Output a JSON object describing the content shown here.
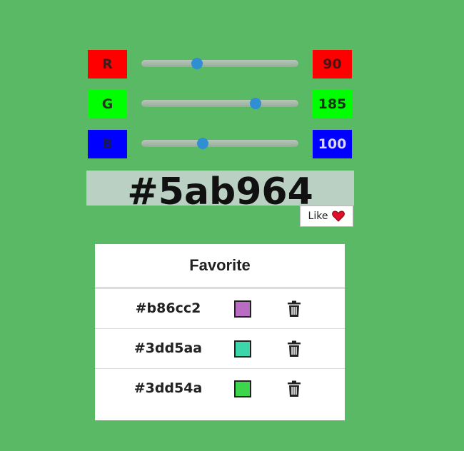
{
  "sliders": {
    "r": {
      "label": "R",
      "value": "90",
      "fraction": 0.353,
      "box_color": "#ff0000"
    },
    "g": {
      "label": "G",
      "value": "185",
      "fraction": 0.725,
      "box_color": "#00ff00"
    },
    "b": {
      "label": "B",
      "value": "100",
      "fraction": 0.392,
      "box_color": "#0000ff"
    }
  },
  "current_color": {
    "hex": "#5ab964"
  },
  "like_button": {
    "label": "Like",
    "icon": "heart-icon",
    "icon_color": "#e0102a"
  },
  "favorites": {
    "title": "Favorite",
    "items": [
      {
        "hex": "#b86cc2",
        "swatch": "#b86cc2",
        "icon": "trash-icon"
      },
      {
        "hex": "#3dd5aa",
        "swatch": "#3dd5aa",
        "icon": "trash-icon"
      },
      {
        "hex": "#3dd54a",
        "swatch": "#3dd54a",
        "icon": "trash-icon"
      }
    ]
  }
}
